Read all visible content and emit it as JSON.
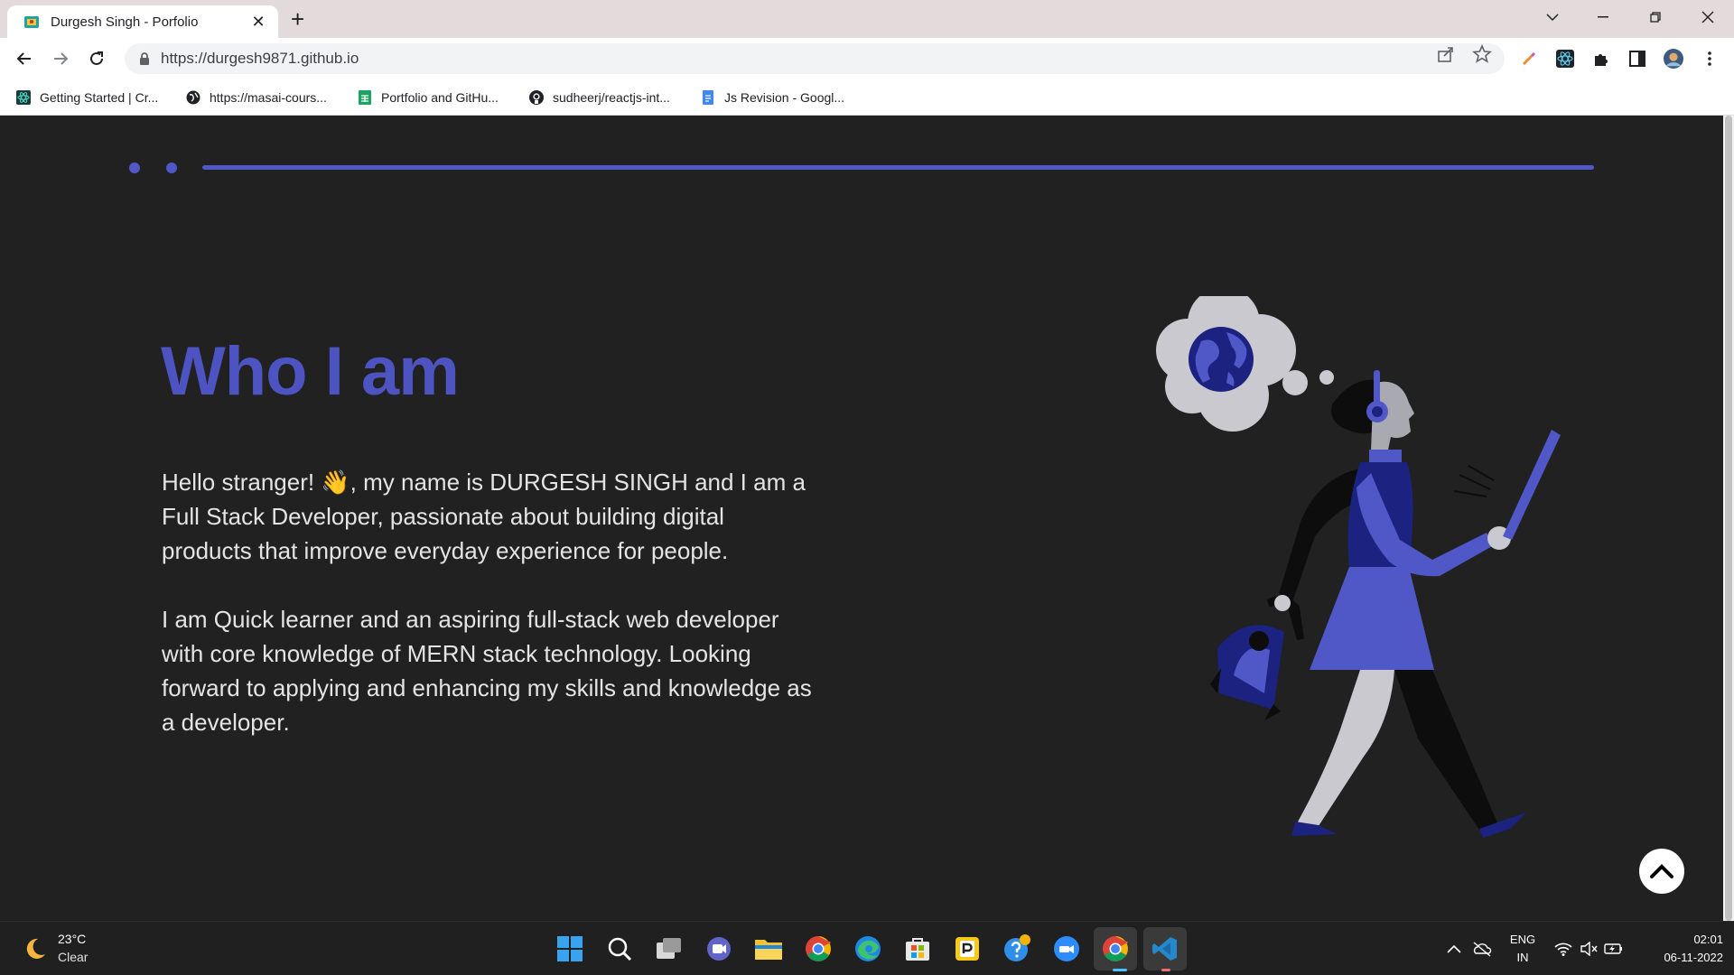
{
  "browser": {
    "tab_title": "Durgesh Singh - Porfolio",
    "close_glyph": "✕",
    "new_tab_glyph": "+",
    "url": "https://durgesh9871.github.io",
    "bookmarks": [
      {
        "label": "Getting Started | Cr...",
        "icon": "react-icon"
      },
      {
        "label": "https://masai-cours...",
        "icon": "globe-icon"
      },
      {
        "label": "Portfolio and GitHu...",
        "icon": "sheets-icon"
      },
      {
        "label": "sudheerj/reactjs-int...",
        "icon": "github-icon"
      },
      {
        "label": "Js Revision - Googl...",
        "icon": "docs-icon"
      }
    ]
  },
  "page": {
    "heading": "Who I am",
    "paragraph1": "Hello stranger! 👋, my name is DURGESH SINGH and I am a Full Stack Developer, passionate about building digital products that improve everyday experience for people.",
    "paragraph2": "I am Quick learner and an aspiring full-stack web developer with core knowledge of MERN stack technology. Looking forward to applying and enhancing my skills and knowledge as a developer.",
    "accent_color": "#5058c8"
  },
  "taskbar": {
    "temperature": "23°C",
    "weather": "Clear",
    "lang_top": "ENG",
    "lang_bottom": "IN",
    "time": "02:01",
    "date": "06-11-2022"
  }
}
